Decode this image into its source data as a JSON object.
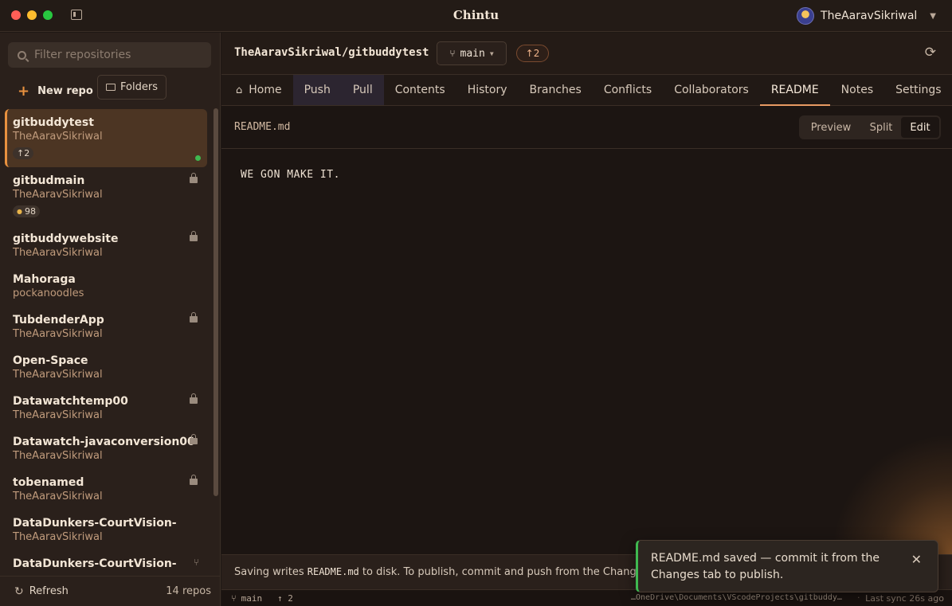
{
  "app": {
    "title": "Chintu"
  },
  "user": {
    "name": "TheAaravSikriwal"
  },
  "sidebar": {
    "filter_placeholder": "Filter repositories",
    "new_repo_label": "New repo",
    "folders_label": "Folders",
    "repos": [
      {
        "name": "gitbuddytest",
        "owner": "TheAaravSikriwal",
        "badge": "↑2",
        "active": true,
        "icon": "green-dot"
      },
      {
        "name": "gitbudmain",
        "owner": "TheAaravSikriwal",
        "badge": "98",
        "icon": "lock-icon"
      },
      {
        "name": "gitbuddywebsite",
        "owner": "TheAaravSikriwal",
        "icon": "lock-icon"
      },
      {
        "name": "Mahoraga",
        "owner": "pockanoodles"
      },
      {
        "name": "TubdenderApp",
        "owner": "TheAaravSikriwal",
        "icon": "lock-icon"
      },
      {
        "name": "Open-Space",
        "owner": "TheAaravSikriwal"
      },
      {
        "name": "Datawatchtemp00",
        "owner": "TheAaravSikriwal",
        "icon": "lock-icon"
      },
      {
        "name": "Datawatch-javaconversion00",
        "owner": "TheAaravSikriwal",
        "icon": "lock-icon"
      },
      {
        "name": "tobenamed",
        "owner": "TheAaravSikriwal",
        "icon": "lock-icon"
      },
      {
        "name": "DataDunkers-CourtVision-",
        "owner": "TheAaravSikriwal"
      },
      {
        "name": "DataDunkers-CourtVision-",
        "owner": "",
        "icon": "fork-icon"
      }
    ],
    "refresh_label": "Refresh",
    "repo_count": "14 repos"
  },
  "header": {
    "repo_path": "TheAaravSikriwal/gitbuddytest",
    "branch": "main",
    "ahead": "↑2"
  },
  "tabs": [
    {
      "label": "Home"
    },
    {
      "label": "Push"
    },
    {
      "label": "Pull"
    },
    {
      "label": "Contents"
    },
    {
      "label": "History"
    },
    {
      "label": "Branches"
    },
    {
      "label": "Conflicts"
    },
    {
      "label": "Collaborators"
    },
    {
      "label": "README"
    },
    {
      "label": "Notes"
    },
    {
      "label": "Settings"
    }
  ],
  "active_tab": "README",
  "file": {
    "name": "README.md",
    "views": [
      "Preview",
      "Split",
      "Edit"
    ],
    "active_view": "Edit",
    "content": "WE GON MAKE IT."
  },
  "hint": {
    "prefix": "Saving writes ",
    "file": "README.md",
    "suffix": " to disk. To publish, commit and push from the Changes tab."
  },
  "status": {
    "branch": "main",
    "ahead": "↑ 2",
    "path": "…OneDrive\\Documents\\VScodeProjects\\gitbuddy…",
    "separator": "·",
    "last_sync": "Last sync 26s ago"
  },
  "toast": {
    "message": "README.md saved — commit it from the Changes tab to publish."
  },
  "colors": {
    "accent": "#e8913f",
    "success": "#3fb950",
    "background": "#1c1512"
  }
}
